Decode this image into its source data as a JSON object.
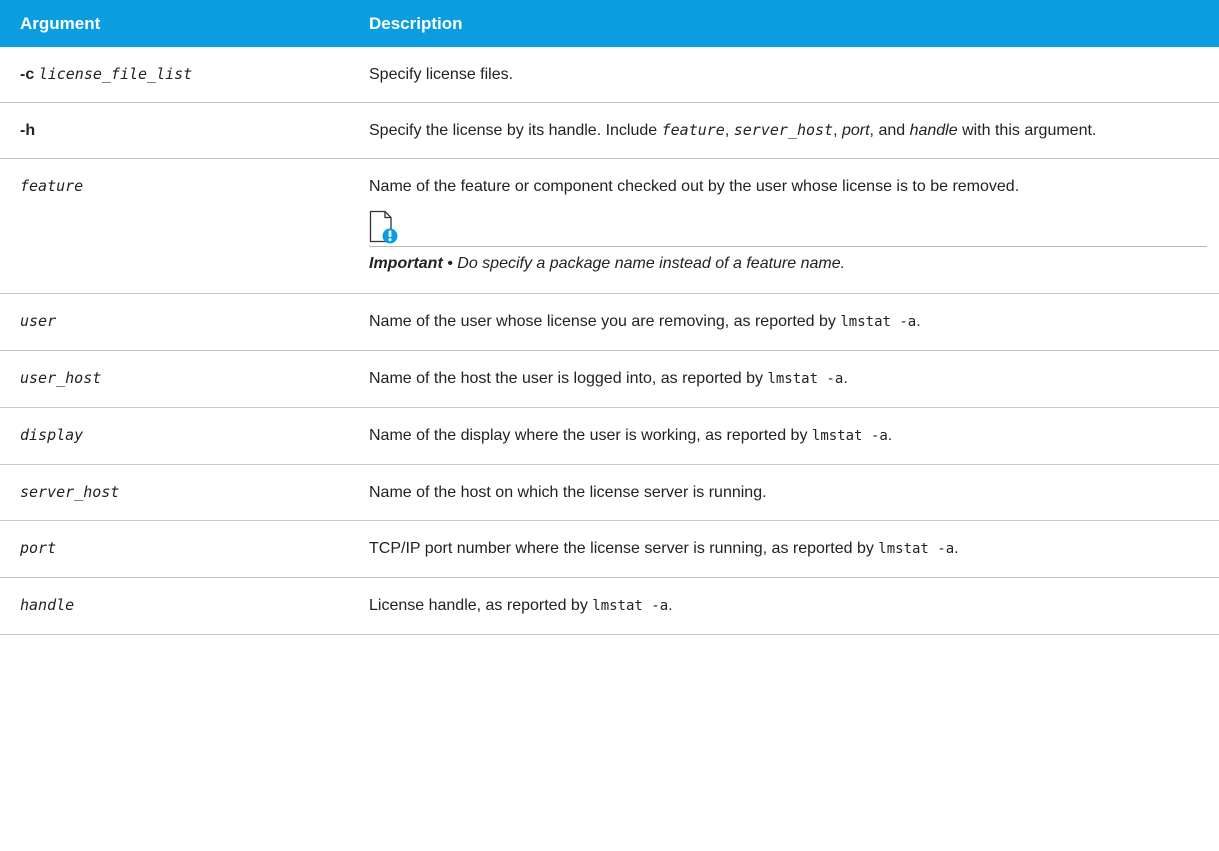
{
  "header": {
    "argument": "Argument",
    "description": "Description"
  },
  "rows": {
    "c": {
      "flag": "-c",
      "param": "license_file_list",
      "desc": "Specify license files."
    },
    "h": {
      "flag": "-h",
      "desc_pre": "Specify the license by its handle. Include ",
      "t1": "feature",
      "s1": ", ",
      "t2": "server_host",
      "s2": ", ",
      "t3": "port",
      "s3": ", and ",
      "t4": "handle",
      "desc_post": " with this argument."
    },
    "feature": {
      "name": "feature",
      "desc": "Name of the feature or component checked out by the user whose license is to be removed.",
      "note_icon": "important-note-icon",
      "note_label": "Important",
      "note_sep": " • ",
      "note_text": "Do specify a package name instead of a feature name.",
      "accent": "#0a9ee0"
    },
    "user": {
      "name": "user",
      "desc": "Name of the user whose license you are removing, as reported by ",
      "code": "lmstat -a",
      "tail": "."
    },
    "user_host": {
      "name": "user_host",
      "desc": "Name of the host the user is logged into, as reported by ",
      "code": "lmstat -a",
      "tail": "."
    },
    "display": {
      "name": "display",
      "desc": "Name of the display where the user is working, as reported by ",
      "code": "lmstat -a",
      "tail": "."
    },
    "server_host": {
      "name": "server_host",
      "desc": "Name of the host on which the license server is running."
    },
    "port": {
      "name": "port",
      "desc": "TCP/IP port number where the license server is running, as reported by ",
      "code": "lmstat -a",
      "tail": "."
    },
    "handle": {
      "name": "handle",
      "desc": "License handle, as reported by ",
      "code": "lmstat -a",
      "tail": "."
    }
  }
}
